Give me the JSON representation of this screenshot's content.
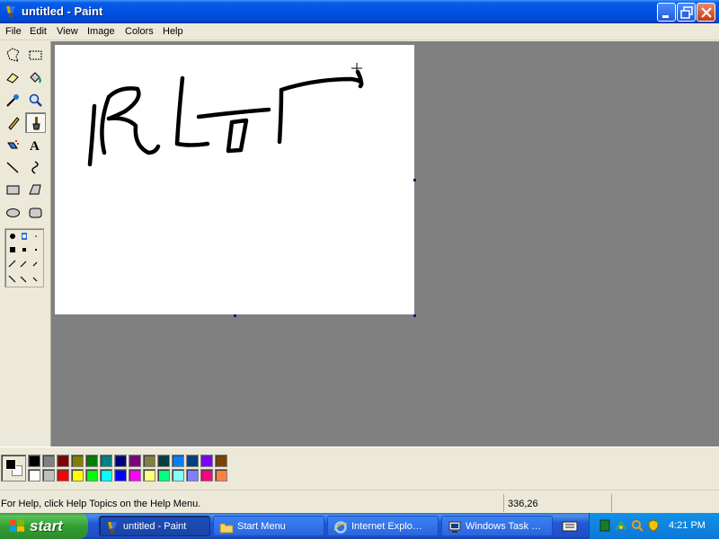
{
  "window": {
    "title": "untitled - Paint",
    "controls": {
      "minimize": "minimize-icon",
      "restore": "restore-icon",
      "close": "close-icon"
    }
  },
  "menu": {
    "items": [
      "File",
      "Edit",
      "View",
      "Image",
      "Colors",
      "Help"
    ]
  },
  "toolbox": {
    "tools": [
      "free-form-select-icon",
      "select-icon",
      "eraser-icon",
      "fill-icon",
      "pick-color-icon",
      "magnifier-icon",
      "pencil-icon",
      "brush-icon",
      "airbrush-icon",
      "text-icon",
      "line-icon",
      "curve-icon",
      "rectangle-icon",
      "polygon-icon",
      "ellipse-icon",
      "rounded-rectangle-icon"
    ],
    "selected_tool": "brush-icon"
  },
  "palette": {
    "foreground": "#000000",
    "background": "#FFFFFF",
    "colors_top": [
      "#000000",
      "#808080",
      "#800000",
      "#808000",
      "#008000",
      "#008080",
      "#000080",
      "#800080",
      "#808040",
      "#004040",
      "#0080FF",
      "#004080",
      "#8000FF",
      "#804000"
    ],
    "colors_bottom": [
      "#FFFFFF",
      "#C0C0C0",
      "#FF0000",
      "#FFFF00",
      "#00FF00",
      "#00FFFF",
      "#0000FF",
      "#FF00FF",
      "#FFFF80",
      "#00FF80",
      "#80FFFF",
      "#8080FF",
      "#FF0080",
      "#FF8040"
    ]
  },
  "status": {
    "help_text": "For Help, click Help Topics on the Help Menu.",
    "coordinates": "336,26"
  },
  "taskbar": {
    "start_label": "start",
    "tasks": [
      {
        "label": "untitled - Paint",
        "icon": "paint-icon",
        "active": true
      },
      {
        "label": "Start Menu",
        "icon": "folder-icon",
        "active": false
      },
      {
        "label": "Internet Explo…",
        "icon": "ie-icon",
        "active": false
      },
      {
        "label": "Windows Task …",
        "icon": "task-manager-icon",
        "active": false
      }
    ],
    "clock": "4:21 PM"
  }
}
